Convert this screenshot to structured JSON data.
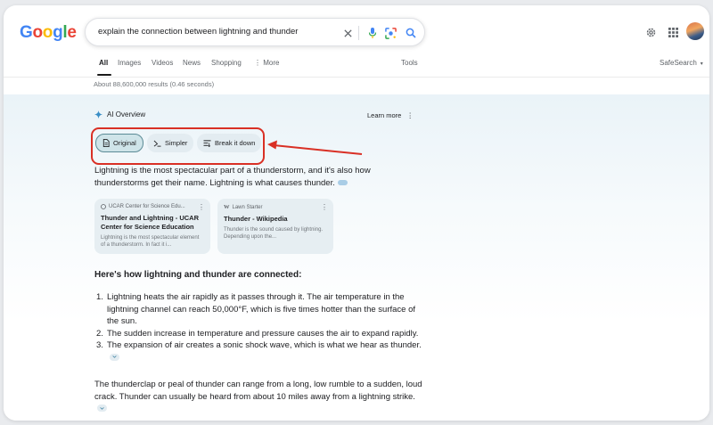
{
  "logo": {
    "letters": [
      "G",
      "o",
      "o",
      "g",
      "l",
      "e"
    ],
    "colors": [
      "#4285f4",
      "#ea4335",
      "#fbbc05",
      "#4285f4",
      "#34a853",
      "#ea4335"
    ]
  },
  "search": {
    "query": "explain the connection between lightning and thunder"
  },
  "icons": {
    "clear": "close-icon",
    "voice": "microphone-icon",
    "lens": "lens-icon",
    "search": "search-icon",
    "settings": "gear-icon",
    "apps": "apps-grid-icon",
    "ai": "sparkle-icon",
    "more": "more-vert-icon"
  },
  "tabs": [
    {
      "label": "All",
      "active": true
    },
    {
      "label": "Images"
    },
    {
      "label": "Videos"
    },
    {
      "label": "News"
    },
    {
      "label": "Shopping"
    },
    {
      "label": "More"
    }
  ],
  "tools_label": "Tools",
  "safesearch_label": "SafeSearch",
  "results_count": "About 88,600,000 results (0.46 seconds)",
  "ai_overview": {
    "title": "AI Overview",
    "learn_more": "Learn more",
    "chips": [
      {
        "label": "Original",
        "active": true
      },
      {
        "label": "Simpler"
      },
      {
        "label": "Break it down"
      }
    ],
    "intro": "Lightning is the most spectacular part of a thunderstorm, and it's also how thunderstorms get their name. Lightning is what causes thunder.",
    "sources": [
      {
        "site": "UCAR Center for Science Edu...",
        "title": "Thunder and Lightning - UCAR Center for Science Education",
        "snippet": "Lightning is the most spectacular element of a thunderstorm. In fact it i..."
      },
      {
        "site": "Lawn Starter",
        "title": "Thunder - Wikipedia",
        "snippet": "Thunder is the sound caused by lightning. Depending upon the..."
      }
    ],
    "subheading": "Here's how lightning and thunder are connected:",
    "steps": [
      "Lightning heats the air rapidly as it passes through it. The air temperature in the lightning channel can reach 50,000°F, which is five times hotter than the surface of the sun.",
      "The sudden increase in temperature and pressure causes the air to expand rapidly.",
      "The expansion of air creates a sonic shock wave, which is what we hear as thunder."
    ],
    "closing": "The thunderclap or peal of thunder can range from a long, low rumble to a sudden, loud crack. Thunder can usually be heard from about 10 miles away from a lightning strike."
  },
  "colors": {
    "highlight_box": "#d93025",
    "chip_bg": "#e3ecf1",
    "chip_active": "#cfe4e9"
  }
}
